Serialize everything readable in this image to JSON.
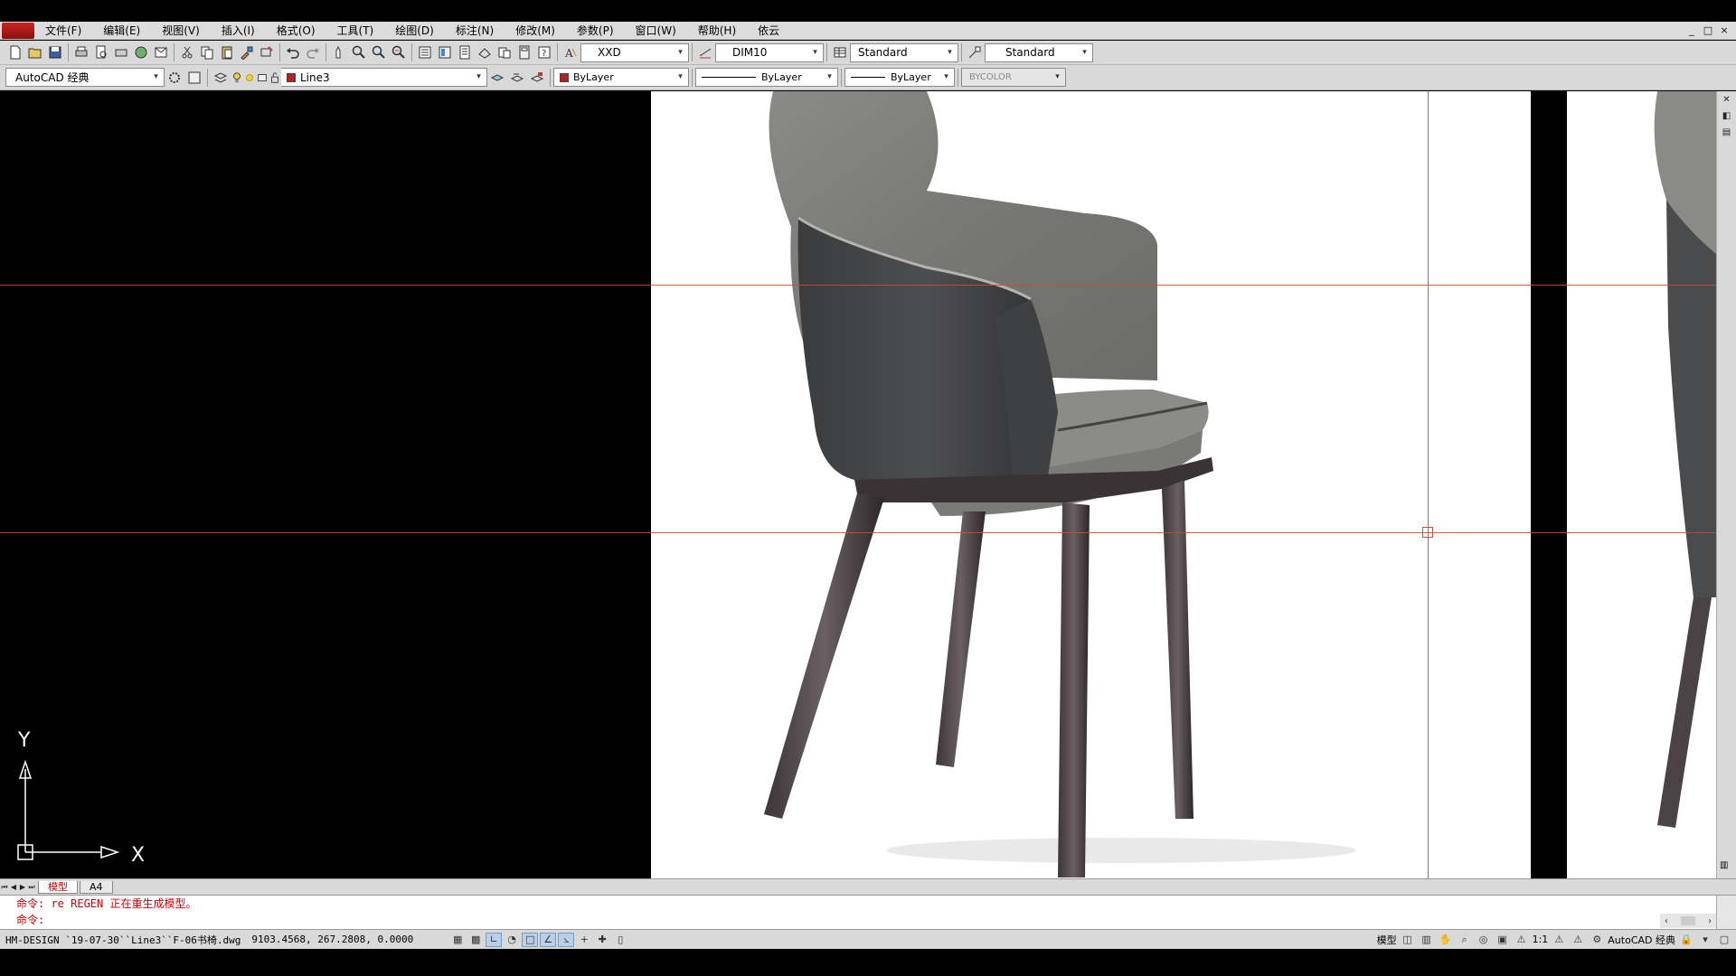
{
  "menu": {
    "items": [
      "文件(F)",
      "编辑(E)",
      "视图(V)",
      "插入(I)",
      "格式(O)",
      "工具(T)",
      "绘图(D)",
      "标注(N)",
      "修改(M)",
      "参数(P)",
      "窗口(W)",
      "帮助(H)",
      "依云"
    ],
    "window_controls": [
      "_",
      "□",
      "×"
    ]
  },
  "toolbar1": {
    "text_style": "XXD",
    "dim_style": "DIM10",
    "table_style": "Standard",
    "multileader_style": "Standard"
  },
  "toolbar2": {
    "workspace": "AutoCAD 经典",
    "layer": "Line3",
    "color": "ByLayer",
    "color_swatch": "#b22222",
    "linetype": "ByLayer",
    "lineweight": "ByLayer",
    "plotstyle": "BYCOLOR"
  },
  "viewport": {
    "ucs_y": "Y",
    "ucs_x": "X",
    "crosshair_color": "#c8502a"
  },
  "tabs": {
    "model": "模型",
    "layout": "A4"
  },
  "command": {
    "history": "命令: re REGEN 正在重生成模型。",
    "prompt": "命令:"
  },
  "status": {
    "file_info": "HM-DESIGN `19-07-30``Line3``F-06书椅.dwg",
    "coordinates": "9103.4568, 267.2808, 0.0000",
    "model_label": "模型",
    "annotation_scale": "1:1",
    "workspace": "AutoCAD 经典"
  },
  "icons": {
    "toolbar1": [
      "new-icon",
      "open-icon",
      "save-icon",
      "print-icon",
      "print-preview-icon",
      "plot-icon",
      "publish-icon",
      "etransmit-icon",
      "cut-icon",
      "copy-icon",
      "paste-icon",
      "matchprop-icon",
      "block-editor-icon",
      "undo-icon",
      "redo-icon",
      "pan-icon",
      "zoom-realtime-icon",
      "zoom-window-icon",
      "zoom-previous-icon",
      "properties-icon",
      "design-center-icon",
      "tool-palette-icon",
      "sheetset-icon",
      "markup-icon",
      "quickcalc-icon",
      "help-icon"
    ],
    "toolbar2": [
      "workspace-settings-icon",
      "workspace-customize-icon",
      "layer-properties-icon",
      "layer-on-icon",
      "layer-thaw-icon",
      "layer-vp-icon",
      "layer-lock-icon",
      "make-current-icon",
      "layer-previous-icon",
      "layer-state-icon"
    ]
  }
}
